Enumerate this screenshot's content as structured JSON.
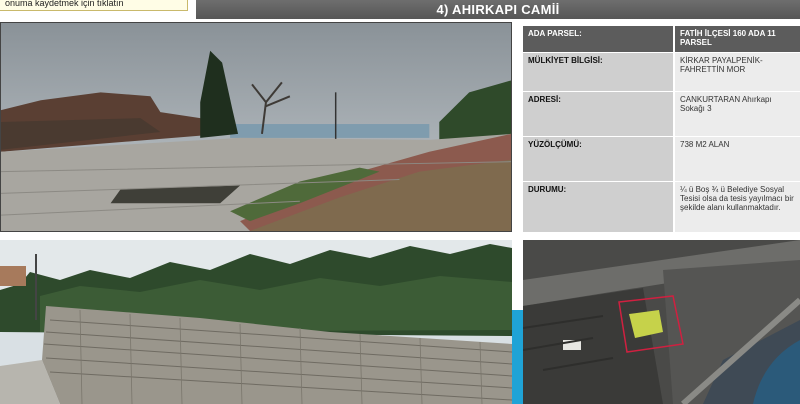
{
  "tooltip": {
    "text": "onuma kaydetmek için tıklatın"
  },
  "slide": {
    "title": "4) AHIRKAPI CAMİİ"
  },
  "info_table": {
    "rows": [
      {
        "label": "ADA PARSEL:",
        "value": "FATİH İLÇESİ 160 ADA 11 PARSEL"
      },
      {
        "label": "MÜLKİYET BİLGİSİ:",
        "value": "KİRKAR PAYALPENİK-FAHRETTİN MOR"
      },
      {
        "label": "ADRESİ:",
        "value": "CANKURTARAN Ahırkapı Sokağı 3"
      },
      {
        "label": "YÜZÖLÇÜMÜ:",
        "value": "738 M2 ALAN"
      },
      {
        "label": "DURUMU:",
        "value": "¼ ü Boş ¾ ü Belediye Sosyal Tesisi olsa da tesis yayılmacı bir şekilde alanı kullanmaktadır."
      }
    ]
  },
  "colors": {
    "title_bar": "#5e5e5e",
    "accent": "#1fa3d6",
    "table_header": "#5c5c5c"
  }
}
